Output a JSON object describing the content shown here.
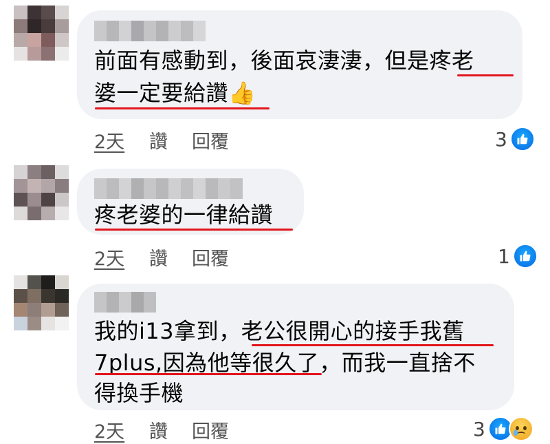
{
  "comments": [
    {
      "lines": [
        "前面有感動到，後面哀淒淒，但是疼老",
        "婆一定要給讚👍"
      ],
      "time": "2天",
      "like_label": "讚",
      "reply_label": "回覆",
      "reaction_count": "3"
    },
    {
      "lines": [
        "疼老婆的一律給讚"
      ],
      "time": "2天",
      "like_label": "讚",
      "reply_label": "回覆",
      "reaction_count": "1"
    },
    {
      "lines": [
        "我的i13拿到，老公很開心的接手我舊",
        "7plus,因為他等很久了，而我一直捨不",
        "得換手機"
      ],
      "time": "2天",
      "like_label": "讚",
      "reply_label": "回覆",
      "reaction_count": "3"
    }
  ],
  "reaction_icons": [
    "like-icon",
    "sad-icon"
  ],
  "colors": {
    "bubble": "#f0f2f5",
    "underline": "#e3141b",
    "like": "#0866ff",
    "action_text": "#545454"
  }
}
